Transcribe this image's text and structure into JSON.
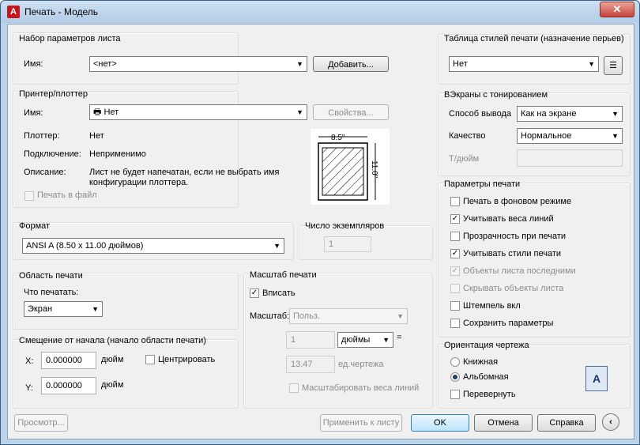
{
  "window": {
    "title": "Печать - Модель",
    "app_icon": "A",
    "close_glyph": "✕"
  },
  "page_setup": {
    "group": "Набор параметров листа",
    "name_label": "Имя:",
    "name_value": "<нет>",
    "add_button": "Добавить..."
  },
  "printer": {
    "group": "Принтер/плоттер",
    "name_label": "Имя:",
    "name_value": "Нет",
    "properties_button": "Свойства...",
    "plotter_label": "Плоттер:",
    "plotter_value": "Нет",
    "connection_label": "Подключение:",
    "connection_value": "Неприменимо",
    "description_label": "Описание:",
    "description_line1": "Лист не будет напечатан, если не выбрать имя",
    "description_line2": "конфигурации плоттера.",
    "print_to_file": "Печать в файл",
    "preview_width": "8.5\"",
    "preview_height": "11.0\""
  },
  "format": {
    "group": "Формат",
    "value": "ANSI A (8.50 x 11.00 дюймов)"
  },
  "copies": {
    "group": "Число экземпляров",
    "value": "1"
  },
  "area": {
    "group": "Область печати",
    "what_label": "Что печатать:",
    "what_value": "Экран"
  },
  "offset": {
    "group": "Смещение от начала (начало области печати)",
    "x_label": "X:",
    "x_value": "0.000000",
    "x_unit": "дюйм",
    "center": "Центрировать",
    "y_label": "Y:",
    "y_value": "0.000000",
    "y_unit": "дюйм"
  },
  "scale": {
    "group": "Масштаб печати",
    "fit": "Вписать",
    "scale_label": "Масштаб:",
    "scale_value": "Польз.",
    "num": "1",
    "unit": "дюймы",
    "equals": "=",
    "den": "13.47",
    "den_unit": "ед.чертежа",
    "scale_lineweights": "Масштабировать веса линий"
  },
  "styles": {
    "group": "Таблица стилей печати (назначение перьев)",
    "value": "Нет"
  },
  "shaded": {
    "group": "ВЭкраны с тонированием",
    "output_label": "Способ вывода",
    "output_value": "Как на экране",
    "quality_label": "Качество",
    "quality_value": "Нормальное",
    "dpi_label": "Т/дюйм"
  },
  "options": {
    "group": "Параметры печати",
    "items": [
      {
        "label": "Печать в фоновом режиме",
        "checked": false,
        "disabled": false
      },
      {
        "label": "Учитывать веса линий",
        "checked": true,
        "disabled": false
      },
      {
        "label": "Прозрачность при печати",
        "checked": false,
        "disabled": false
      },
      {
        "label": "Учитывать стили печати",
        "checked": true,
        "disabled": false
      },
      {
        "label": "Объекты листа последними",
        "checked": true,
        "disabled": true
      },
      {
        "label": "Скрывать объекты листа",
        "checked": false,
        "disabled": true
      },
      {
        "label": "Штемпель вкл",
        "checked": false,
        "disabled": false
      },
      {
        "label": "Сохранить параметры",
        "checked": false,
        "disabled": false
      }
    ]
  },
  "orientation": {
    "group": "Ориентация чертежа",
    "portrait": "Книжная",
    "landscape": "Альбомная",
    "upside_down": "Перевернуть",
    "icon_letter": "A"
  },
  "footer": {
    "preview": "Просмотр...",
    "apply": "Применить к листу",
    "ok": "OK",
    "cancel": "Отмена",
    "help": "Справка",
    "collapse_glyph": "‹"
  }
}
